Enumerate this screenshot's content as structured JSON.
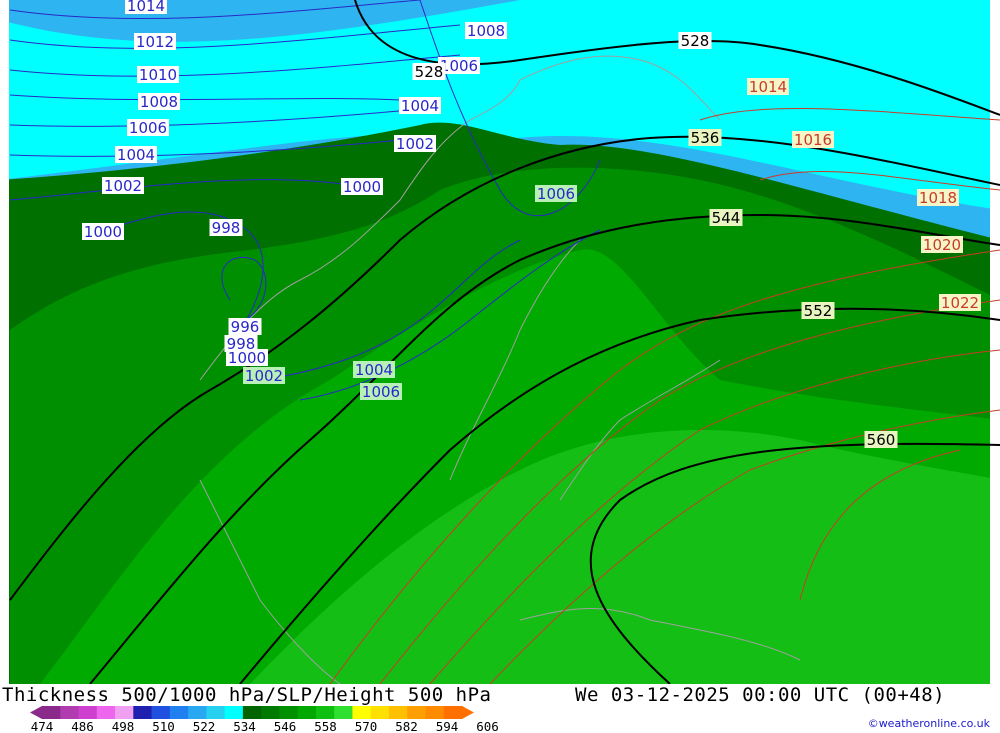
{
  "map": {
    "footer_title": "Thickness 500/1000 hPa/SLP/Height 500 hPa",
    "footer_date": "We 03-12-2025 00:00 UTC (00+48)",
    "copyright": "©weatheronline.co.uk",
    "colors": {
      "thick_516": "#2eb4f0",
      "thick_522": "#00ffff",
      "thick_528": "#007000",
      "thick_534": "#008f00",
      "thick_540": "#00aa00",
      "thick_546": "#14be14",
      "slp_low": "#2828c8",
      "slp_high": "#c83c28",
      "geopotential": "#000000",
      "coast": "#a0a0a0"
    },
    "legend": {
      "ticks": [
        "474",
        "486",
        "498",
        "510",
        "522",
        "534",
        "546",
        "558",
        "570",
        "582",
        "594",
        "606"
      ],
      "colors": [
        "#8a2a8a",
        "#b03cb0",
        "#d040d0",
        "#ee66ee",
        "#f0a0f0",
        "#2020b0",
        "#2050e0",
        "#2080f0",
        "#28a8f0",
        "#28d0f0",
        "#00ffff",
        "#006400",
        "#007a00",
        "#009000",
        "#00a800",
        "#10c010",
        "#30e030",
        "#ffff00",
        "#ffe000",
        "#ffc000",
        "#ffa000",
        "#ff8c00",
        "#ff7000"
      ]
    },
    "slp_labels": [
      {
        "text": "1014",
        "kind": "low"
      },
      {
        "text": "1012",
        "kind": "low"
      },
      {
        "text": "1010",
        "kind": "low"
      },
      {
        "text": "1008",
        "kind": "low"
      },
      {
        "text": "1006",
        "kind": "low"
      },
      {
        "text": "1004",
        "kind": "low"
      },
      {
        "text": "1002",
        "kind": "low"
      },
      {
        "text": "1000",
        "kind": "low"
      },
      {
        "text": "998",
        "kind": "low"
      },
      {
        "text": "1008",
        "kind": "low"
      },
      {
        "text": "1006",
        "kind": "low"
      },
      {
        "text": "1004",
        "kind": "low"
      },
      {
        "text": "1002",
        "kind": "low"
      },
      {
        "text": "1000",
        "kind": "low"
      },
      {
        "text": "1006",
        "kind": "green"
      },
      {
        "text": "996",
        "kind": "low"
      },
      {
        "text": "998",
        "kind": "low"
      },
      {
        "text": "1000",
        "kind": "low"
      },
      {
        "text": "1002",
        "kind": "green"
      },
      {
        "text": "1004",
        "kind": "green"
      },
      {
        "text": "1006",
        "kind": "green"
      },
      {
        "text": "1014",
        "kind": "high"
      },
      {
        "text": "1016",
        "kind": "high"
      },
      {
        "text": "1018",
        "kind": "high"
      },
      {
        "text": "1020",
        "kind": "high"
      },
      {
        "text": "1022",
        "kind": "high"
      }
    ],
    "height_labels": [
      "528",
      "528",
      "536",
      "544",
      "552",
      "560"
    ]
  }
}
